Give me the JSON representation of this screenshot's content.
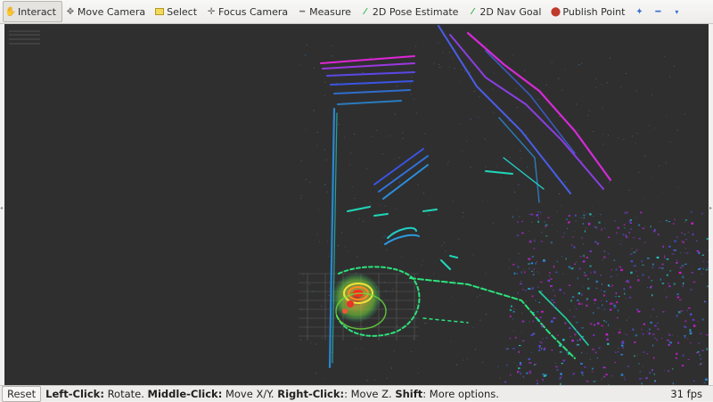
{
  "toolbar": {
    "tools": [
      {
        "label": "Interact",
        "icon": "hand-icon",
        "active": true
      },
      {
        "label": "Move Camera",
        "icon": "move-camera-icon"
      },
      {
        "label": "Select",
        "icon": "select-icon"
      },
      {
        "label": "Focus Camera",
        "icon": "focus-camera-icon"
      },
      {
        "label": "Measure",
        "icon": "measure-icon"
      },
      {
        "label": "2D Pose Estimate",
        "icon": "pose-arrow-icon"
      },
      {
        "label": "2D Nav Goal",
        "icon": "nav-goal-arrow-icon"
      },
      {
        "label": "Publish Point",
        "icon": "map-pin-icon"
      }
    ]
  },
  "status": {
    "reset_label": "Reset",
    "hint_left_key": "Left-Click:",
    "hint_left_action": " Rotate. ",
    "hint_middle_key": "Middle-Click:",
    "hint_middle_action": " Move X/Y. ",
    "hint_right_key": "Right-Click:",
    "hint_right_action": ": Move Z. ",
    "hint_shift_key": "Shift",
    "hint_shift_action": ": More options.",
    "fps": "31 fps"
  },
  "colors": {
    "viewport_background": "#2f2f30",
    "point_cloud_magenta": "#d61bd6",
    "point_cloud_blue": "#3a4fe0",
    "point_cloud_cyan": "#18d6c0",
    "point_cloud_green": "#2de07a",
    "point_cloud_yellow": "#e8e032",
    "point_cloud_red": "#e83020"
  }
}
